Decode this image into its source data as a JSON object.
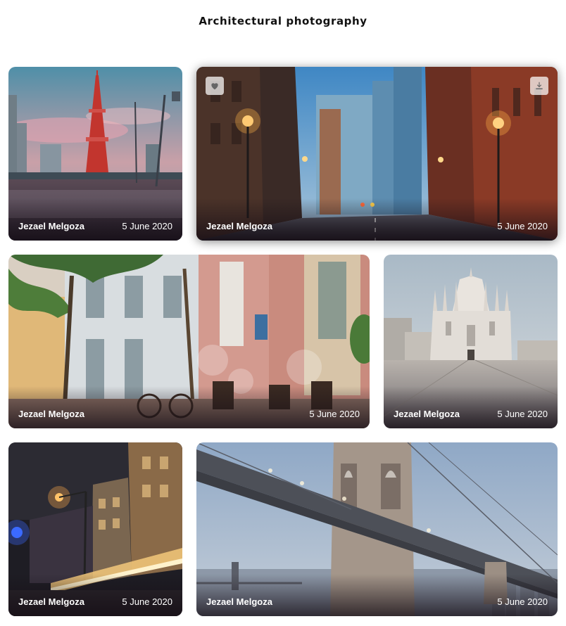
{
  "page": {
    "title": "Architectural Photography"
  },
  "colors": {
    "text_light": "#ffffff",
    "button_bg": "#e6e6e6",
    "icon": "#666666"
  },
  "cards": [
    {
      "author": "Jezael Melgoza",
      "date": "5 June 2020",
      "subject": "tokyo-tower-street"
    },
    {
      "author": "Jezael Melgoza",
      "date": "5 June 2020",
      "subject": "city-street-at-dusk",
      "icons": [
        "heart-icon",
        "download-icon"
      ]
    },
    {
      "author": "Jezael Melgoza",
      "date": "5 June 2020",
      "subject": "sunlit-facades-cafe"
    },
    {
      "author": "Jezael Melgoza",
      "date": "5 June 2020",
      "subject": "milan-cathedral-plaza"
    },
    {
      "author": "Jezael Melgoza",
      "date": "5 June 2020",
      "subject": "night-street-light-trails"
    },
    {
      "author": "Jezael Melgoza",
      "date": "5 June 2020",
      "subject": "brooklyn-bridge-fog"
    }
  ]
}
